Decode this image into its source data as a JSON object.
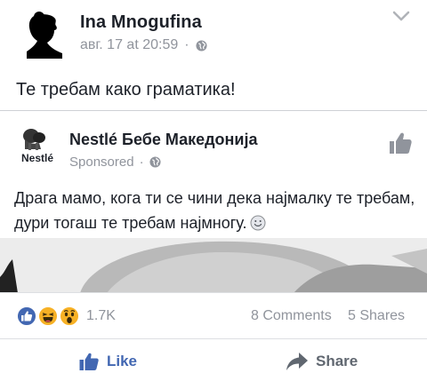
{
  "post": {
    "author": "Ina Mnogufina",
    "timestamp": "авг. 17 at 20:59",
    "separator": "·",
    "privacy_icon": "globe-icon",
    "text": "Те требам како граматика!"
  },
  "shared_post": {
    "page_name": "Nestlé Бебе Македонија",
    "sponsored_label": "Sponsored",
    "separator": "·",
    "logo_text": "Nestlé",
    "text": "Драга мамо, кога ти се чини дека најмалку те требам, дури тогаш те требам најмногу."
  },
  "reactions": {
    "icons": [
      "like-reaction-icon",
      "haha-reaction-icon",
      "wow-reaction-icon"
    ],
    "count": "1.7K",
    "comments": "8 Comments",
    "shares": "5 Shares"
  },
  "actions": {
    "like_label": "Like",
    "share_label": "Share"
  },
  "colors": {
    "accent": "#4267b2",
    "secondary_text": "#90949c",
    "primary_text": "#1d2129"
  }
}
